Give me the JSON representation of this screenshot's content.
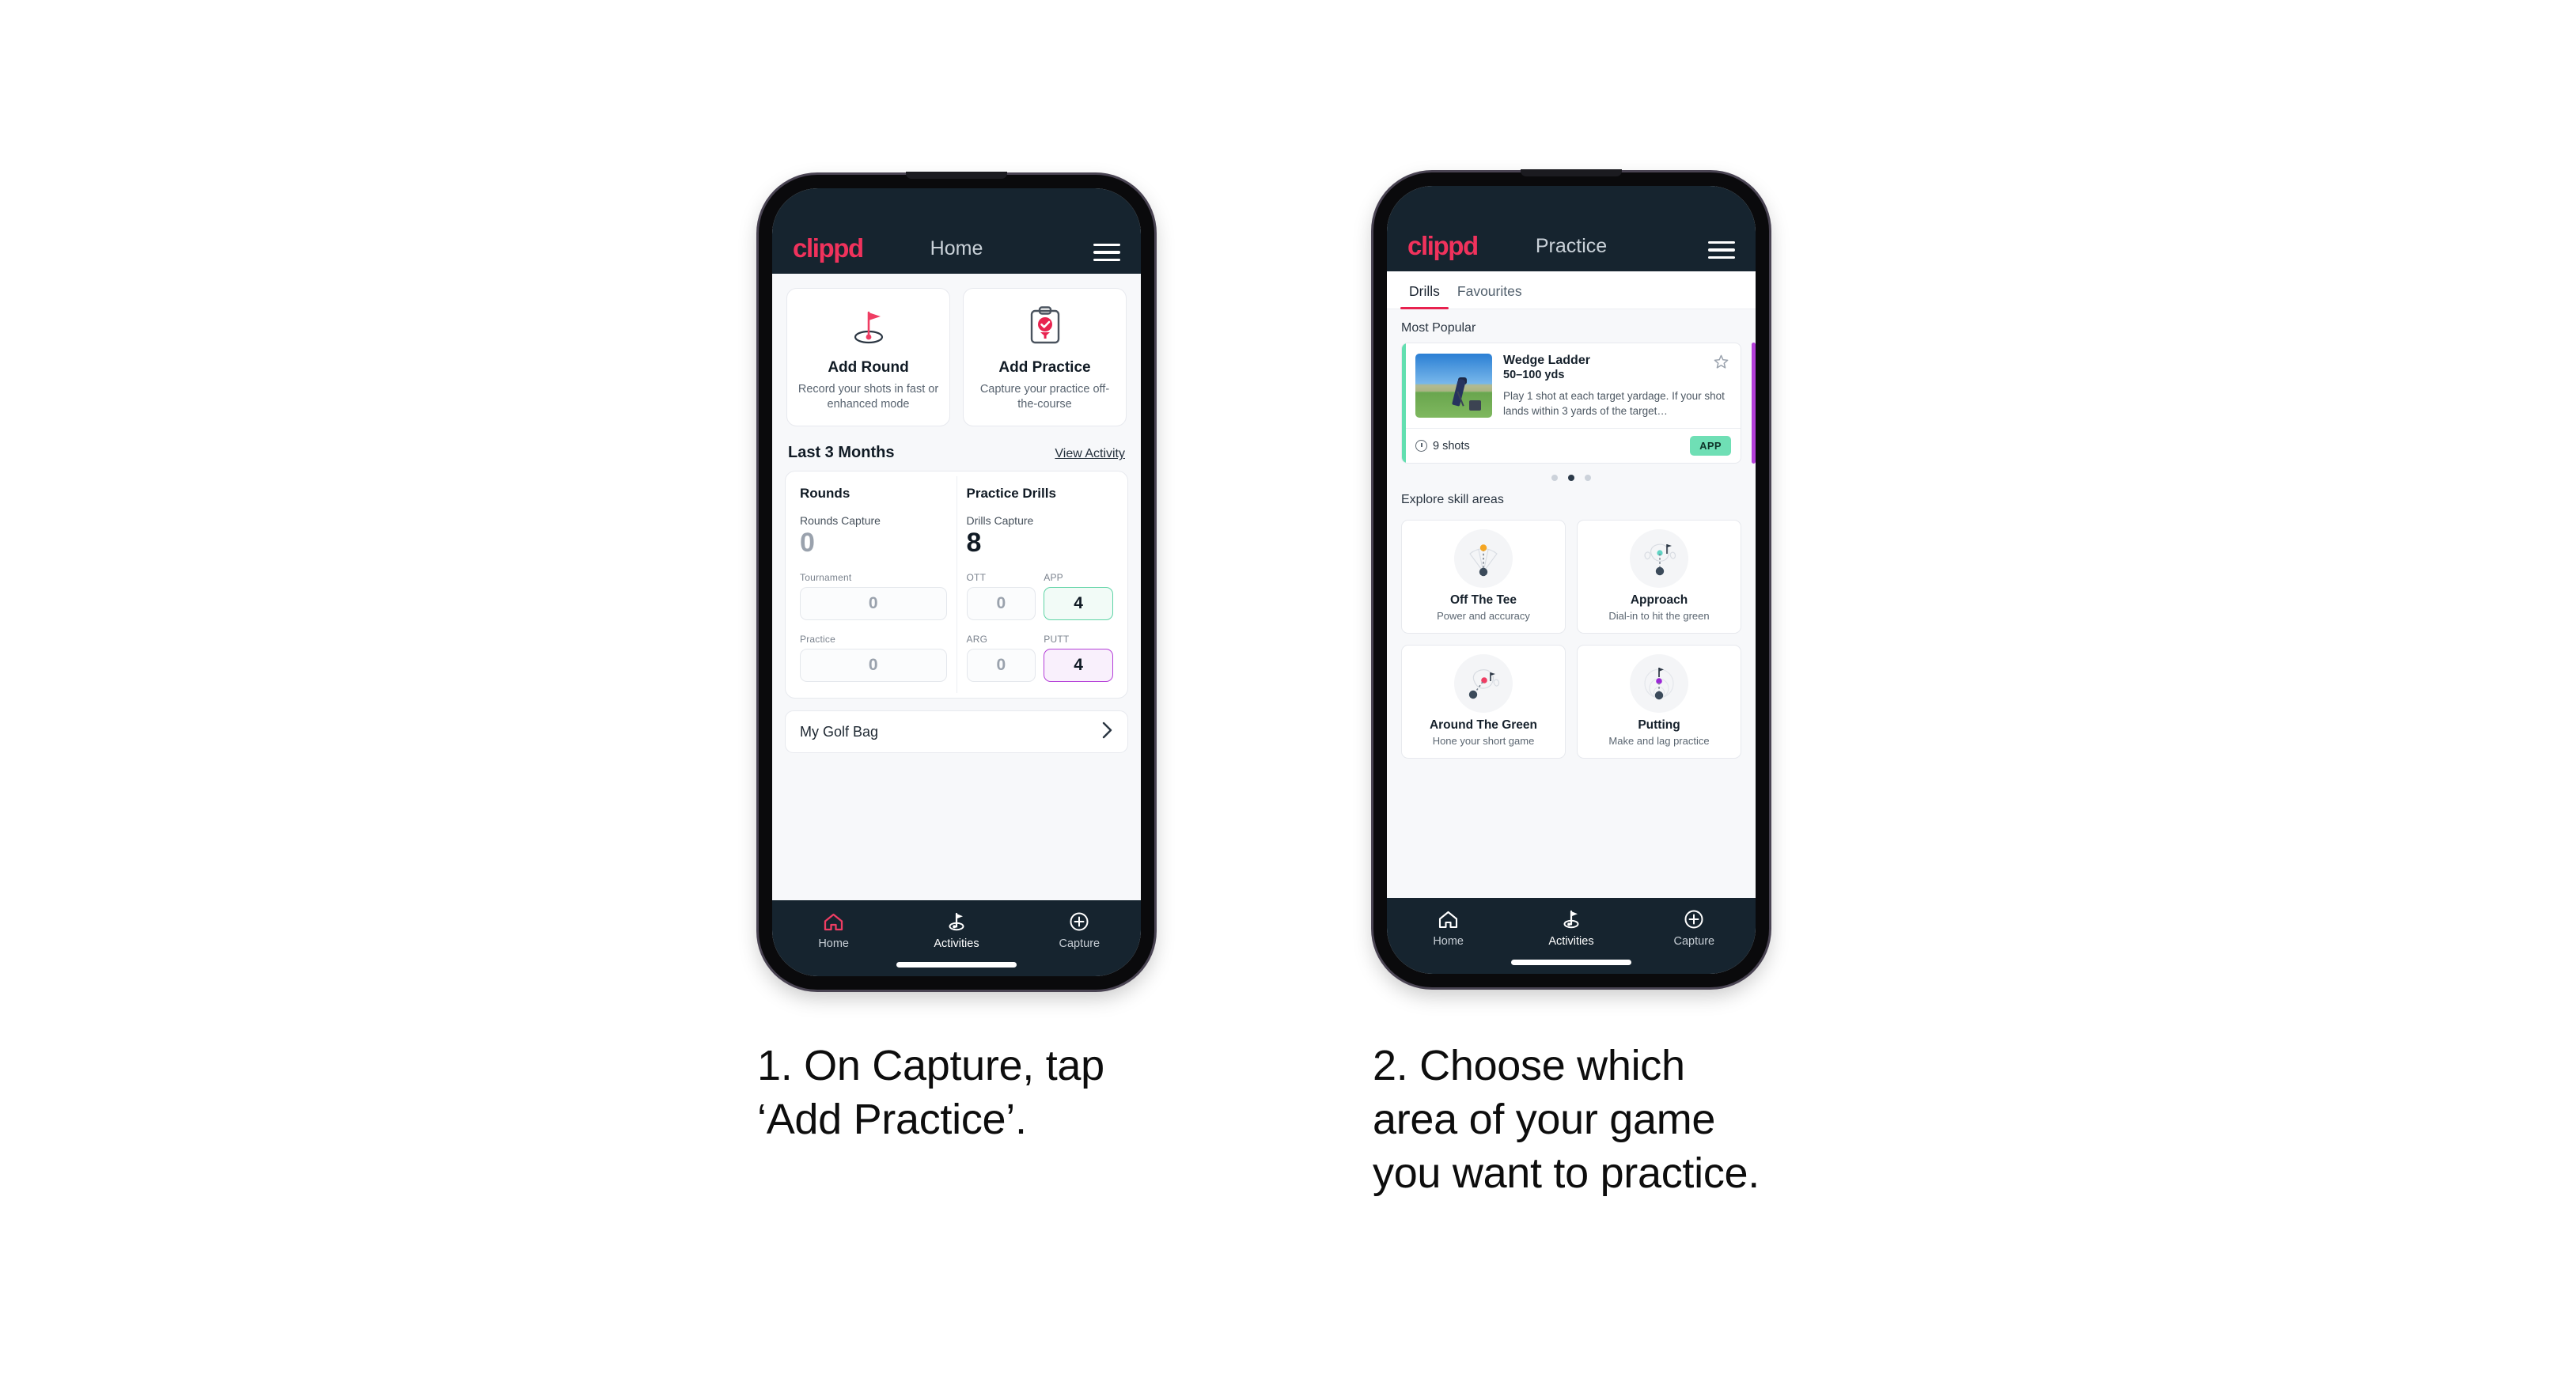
{
  "phone1": {
    "header": {
      "brand": "clippd",
      "title": "Home",
      "menu_icon": "hamburger-icon"
    },
    "actions": [
      {
        "icon": "golf-flag-hole-icon",
        "title": "Add Round",
        "sub": "Record your shots in fast or enhanced mode"
      },
      {
        "icon": "clipboard-check-icon",
        "title": "Add Practice",
        "sub": "Capture your practice off-the-course"
      }
    ],
    "section": {
      "title": "Last 3 Months",
      "link": "View Activity"
    },
    "rounds": {
      "heading": "Rounds",
      "capture_label": "Rounds Capture",
      "capture_value": "0",
      "metrics": [
        {
          "label": "Tournament",
          "value": "0",
          "accent": "none"
        },
        {
          "label": "Practice",
          "value": "0",
          "accent": "none"
        }
      ]
    },
    "drills": {
      "heading": "Practice Drills",
      "capture_label": "Drills Capture",
      "capture_value": "8",
      "metrics": [
        {
          "label": "OTT",
          "value": "0",
          "accent": "none"
        },
        {
          "label": "APP",
          "value": "4",
          "accent": "green"
        },
        {
          "label": "ARG",
          "value": "0",
          "accent": "none"
        },
        {
          "label": "PUTT",
          "value": "4",
          "accent": "purple"
        }
      ]
    },
    "golf_bag": {
      "label": "My Golf Bag",
      "chevron": "chevron-right-icon"
    },
    "tabbar": [
      {
        "icon": "home-icon",
        "label": "Home",
        "active": true
      },
      {
        "icon": "golf-flag-icon",
        "label": "Activities",
        "active": false
      },
      {
        "icon": "plus-circle-icon",
        "label": "Capture",
        "active": false
      }
    ]
  },
  "phone2": {
    "header": {
      "brand": "clippd",
      "title": "Practice",
      "menu_icon": "hamburger-icon"
    },
    "tabs": [
      {
        "label": "Drills",
        "selected": true
      },
      {
        "label": "Favourites",
        "selected": false
      }
    ],
    "most_popular_label": "Most Popular",
    "drill": {
      "name": "Wedge Ladder",
      "yardage": "50–100 yds",
      "description": "Play 1 shot at each target yardage. If your shot lands within 3 yards of the target…",
      "shots": "9 shots",
      "badge": "APP",
      "badge_color": "#6fdfb5",
      "accent_color": "#62dfb0",
      "favourite_icon": "star-outline-icon",
      "shots_icon": "clock-icon",
      "thumbnail": "golfer-chipping-photo"
    },
    "carousel_dots": {
      "count": 3,
      "active_index": 1
    },
    "explore_label": "Explore skill areas",
    "skills": [
      {
        "icon": "off-the-tee-icon",
        "name": "Off The Tee",
        "sub": "Power and accuracy",
        "dot_color": "#f5a623"
      },
      {
        "icon": "approach-icon",
        "name": "Approach",
        "sub": "Dial-in to hit the green",
        "dot_color": "#5fd4c4"
      },
      {
        "icon": "around-the-green-icon",
        "name": "Around The Green",
        "sub": "Hone your short game",
        "dot_color": "#ef3d63"
      },
      {
        "icon": "putting-icon",
        "name": "Putting",
        "sub": "Make and lag practice",
        "dot_color": "#9b27d6"
      }
    ],
    "tabbar": [
      {
        "icon": "home-icon",
        "label": "Home",
        "active": false
      },
      {
        "icon": "golf-flag-icon",
        "label": "Activities",
        "active": true
      },
      {
        "icon": "plus-circle-icon",
        "label": "Capture",
        "active": false
      }
    ]
  },
  "captions": {
    "one": "1. On Capture, tap\n‘Add Practice’.",
    "two": "2. Choose which\narea of your game\nyou want to practice."
  },
  "colors": {
    "brand_pink": "#f0325c",
    "header_navy": "#16242f",
    "accent_green": "#62dfb0",
    "accent_purple": "#b43fd8",
    "tab_underline": "#e8224f"
  }
}
